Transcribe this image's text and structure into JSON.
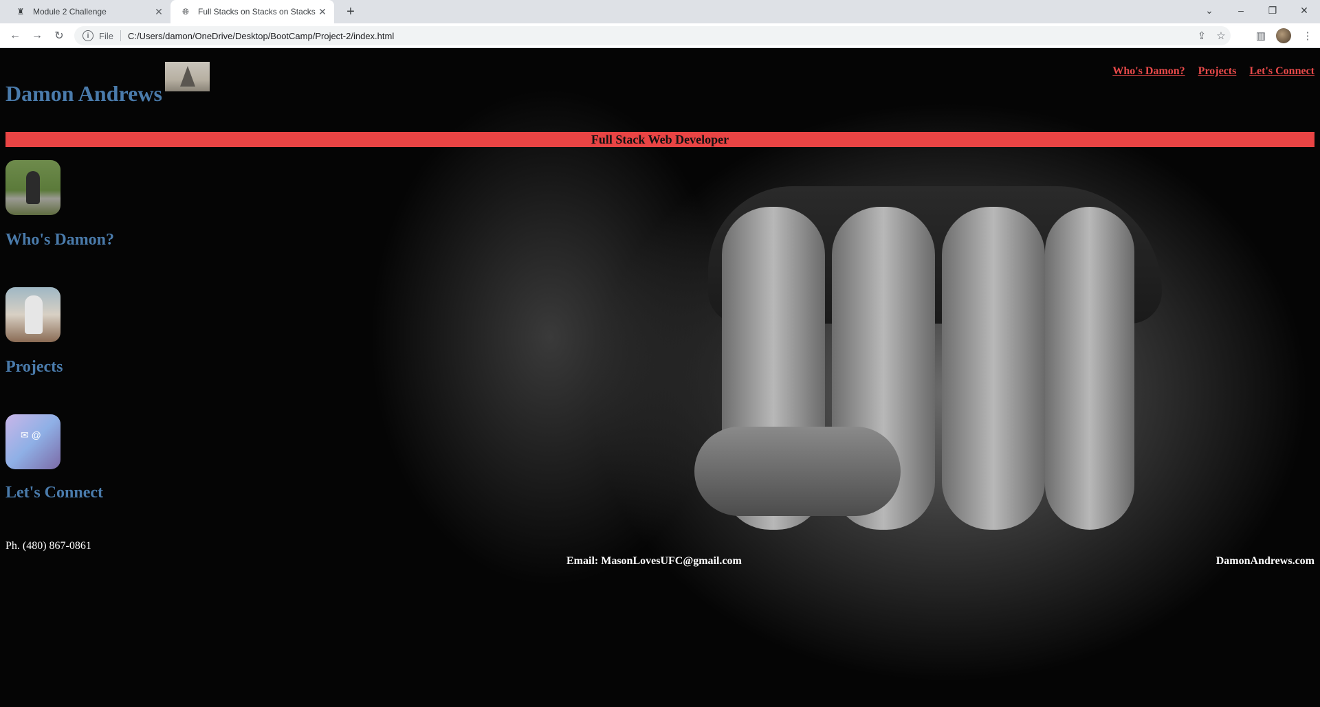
{
  "browser": {
    "tabs": [
      {
        "title": "Module 2 Challenge",
        "icon": "document-icon"
      },
      {
        "title": "Full Stacks on Stacks on Stacks",
        "icon": "globe-icon"
      }
    ],
    "address": {
      "scheme": "File",
      "url": "C:/Users/damon/OneDrive/Desktop/BootCamp/Project-2/index.html"
    }
  },
  "header": {
    "brand": "Damon Andrews",
    "nav": [
      "Who's Damon?",
      "Projects",
      "Let's Connect"
    ],
    "banner": "Full Stack Web Developer"
  },
  "sections": [
    {
      "title": "Who's Damon?"
    },
    {
      "title": "Projects"
    },
    {
      "title": "Let's Connect"
    }
  ],
  "footer": {
    "phone": "Ph. (480) 867-0861",
    "email": "Email: MasonLovesUFC@gmail.com",
    "site": "DamonAndrews.com"
  },
  "colors": {
    "accent": "#e94444",
    "heading": "#4a7bab"
  }
}
